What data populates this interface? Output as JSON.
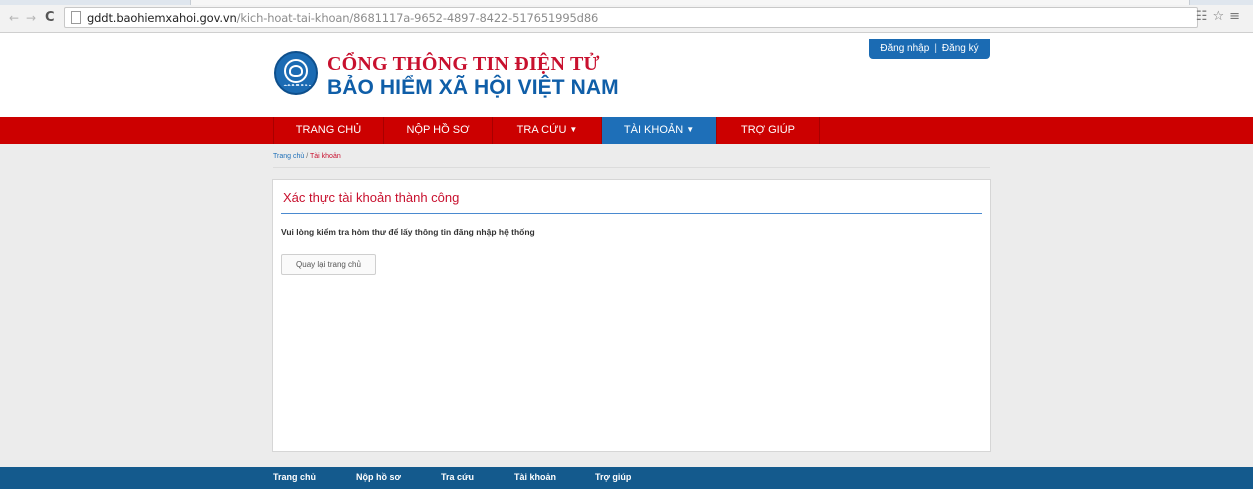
{
  "browser": {
    "url_host": "gddt.baohiemxahoi.gov.vn",
    "url_path": "/kich-hoat-tai-khoan/8681117a-9652-4897-8422-517651995d86",
    "back_glyph": "←",
    "forward_glyph": "→",
    "reload_glyph": "C",
    "extra_icons": "☷☆≡"
  },
  "header": {
    "title_line1": "CỔNG THÔNG TIN ĐIỆN TỬ",
    "title_line2": "BẢO HIỂM XÃ HỘI VIỆT NAM",
    "login_label": "Đăng nhập",
    "separator": "|",
    "register_label": "Đăng ký"
  },
  "nav": {
    "items": [
      {
        "label": "TRANG CHỦ",
        "dropdown": false
      },
      {
        "label": "NỘP HỒ SƠ",
        "dropdown": false
      },
      {
        "label": "TRA CỨU",
        "dropdown": true
      },
      {
        "label": "TÀI KHOẢN",
        "dropdown": true
      },
      {
        "label": "TRỢ GIÚP",
        "dropdown": false
      }
    ],
    "caret": "▼",
    "active_index": 3
  },
  "breadcrumb": {
    "home": "Trang chủ",
    "separator": " / ",
    "current": "Tài khoản"
  },
  "panel": {
    "title": "Xác thực tài khoản thành công",
    "message": "Vui lòng kiểm tra hòm thư để lấy thông tin đăng nhập hệ thống",
    "back_button": "Quay lại trang chủ"
  },
  "footer": {
    "links": [
      "Trang chủ",
      "Nộp hồ sơ",
      "Tra cứu",
      "Tài khoản",
      "Trợ giúp"
    ]
  },
  "colors": {
    "brand_red": "#cc0000",
    "brand_blue": "#1e6fb8",
    "footer_blue": "#145a8d"
  }
}
